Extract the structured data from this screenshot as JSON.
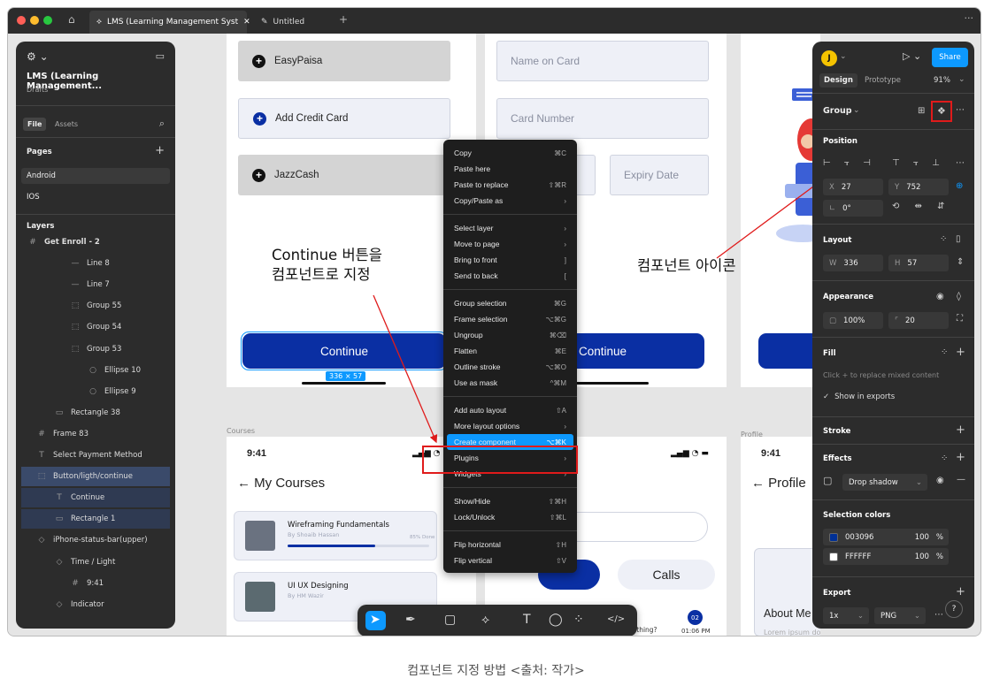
{
  "titlebar": {
    "tabs": [
      {
        "label": "LMS (Learning Management Syst"
      },
      {
        "label": "Untitled"
      }
    ],
    "more": "···"
  },
  "left_panel": {
    "project_title": "LMS (Learning Management...",
    "project_subtitle": "Drafts",
    "file_tab": "File",
    "assets_tab": "Assets",
    "pages_label": "Pages",
    "pages": [
      "Android",
      "IOS"
    ],
    "layers_label": "Layers",
    "layers": [
      {
        "label": "Get Enroll - 2",
        "icon": "#"
      },
      {
        "label": "Line 8",
        "icon": "—"
      },
      {
        "label": "Line 7",
        "icon": "—"
      },
      {
        "label": "Group 55",
        "icon": "⬚"
      },
      {
        "label": "Group 54",
        "icon": "⬚"
      },
      {
        "label": "Group 53",
        "icon": "⬚"
      },
      {
        "label": "Ellipse 10",
        "icon": "○"
      },
      {
        "label": "Ellipse 9",
        "icon": "○"
      },
      {
        "label": "Rectangle 38",
        "icon": "▭"
      },
      {
        "label": "Frame 83",
        "icon": "#"
      },
      {
        "label": "Select Payment Method",
        "icon": "T"
      },
      {
        "label": "Button/ligth/continue",
        "icon": "⬚"
      },
      {
        "label": "Continue",
        "icon": "T"
      },
      {
        "label": "Rectangle 1",
        "icon": "▭"
      },
      {
        "label": "iPhone-status-bar(upper)",
        "icon": "◇"
      },
      {
        "label": "Time / Light",
        "icon": "◇"
      },
      {
        "label": "9:41",
        "icon": "#"
      },
      {
        "label": "Indicator",
        "icon": "◇"
      }
    ]
  },
  "canvas": {
    "payment_methods": [
      "EasyPaisa",
      "Add Credit Card",
      "JazzCash"
    ],
    "fields": {
      "name_on_card": "Name on Card",
      "card_number": "Card Number",
      "expiry_date": "Expiry Date"
    },
    "continue_label": "Continue",
    "selection_size": "336 × 57",
    "frame_labels": {
      "courses": "Courses",
      "profile": "Profile"
    },
    "courses_frame": {
      "time": "9:41",
      "title": "← My Courses",
      "courses": [
        {
          "name": "Wireframing Fundamentals",
          "author": "By Shoaib Hassan",
          "progress_text": "85% Done",
          "progress": 0.62
        },
        {
          "name": "UI UX Designing",
          "author": "By HM Wazir"
        }
      ]
    },
    "middle_frame": {
      "calls_label": "Calls",
      "message": "Hi, How's you? How's everything?",
      "badge": "02",
      "time_sent": "01:06 PM"
    },
    "profile_frame": {
      "time": "9:41",
      "title": "← Profile",
      "about": "About Me",
      "lorem": "Lorem ipsum dolor sit amet consectetur. Fero"
    }
  },
  "annotations": {
    "left_line1": "Continue 버튼을",
    "left_line2": "컴포넌트로 지정",
    "right": "컴포넌트 아이콘"
  },
  "context_menu": {
    "groups": [
      [
        {
          "label": "Copy",
          "shortcut": "⌘C"
        },
        {
          "label": "Paste here",
          "shortcut": ""
        },
        {
          "label": "Paste to replace",
          "shortcut": "⇧⌘R"
        },
        {
          "label": "Copy/Paste as",
          "shortcut": "›"
        }
      ],
      [
        {
          "label": "Select layer",
          "shortcut": "›"
        },
        {
          "label": "Move to page",
          "shortcut": "›"
        },
        {
          "label": "Bring to front",
          "shortcut": "]"
        },
        {
          "label": "Send to back",
          "shortcut": "["
        }
      ],
      [
        {
          "label": "Group selection",
          "shortcut": "⌘G"
        },
        {
          "label": "Frame selection",
          "shortcut": "⌥⌘G"
        },
        {
          "label": "Ungroup",
          "shortcut": "⌘⌫"
        },
        {
          "label": "Flatten",
          "shortcut": "⌘E"
        },
        {
          "label": "Outline stroke",
          "shortcut": "⌥⌘O"
        },
        {
          "label": "Use as mask",
          "shortcut": "^⌘M"
        }
      ],
      [
        {
          "label": "Add auto layout",
          "shortcut": "⇧A"
        },
        {
          "label": "More layout options",
          "shortcut": "›"
        },
        {
          "label": "Create component",
          "shortcut": "⌥⌘K"
        },
        {
          "label": "Plugins",
          "shortcut": "›"
        },
        {
          "label": "Widgets",
          "shortcut": "›"
        }
      ],
      [
        {
          "label": "Show/Hide",
          "shortcut": "⇧⌘H"
        },
        {
          "label": "Lock/Unlock",
          "shortcut": "⇧⌘L"
        }
      ],
      [
        {
          "label": "Flip horizontal",
          "shortcut": "⇧H"
        },
        {
          "label": "Flip vertical",
          "shortcut": "⇧V"
        }
      ]
    ]
  },
  "right_panel": {
    "avatar": "J",
    "share": "Share",
    "design_tab": "Design",
    "prototype_tab": "Prototype",
    "zoom": "91%",
    "group_label": "Group",
    "position_label": "Position",
    "x_label": "X",
    "x_value": "27",
    "y_label": "Y",
    "y_value": "752",
    "rotation": "0°",
    "layout_label": "Layout",
    "w_label": "W",
    "w_value": "336",
    "h_label": "H",
    "h_value": "57",
    "appearance_label": "Appearance",
    "opacity": "100%",
    "radius": "20",
    "fill_label": "Fill",
    "fill_hint": "Click + to replace mixed content",
    "show_in_exports": "Show in exports",
    "stroke_label": "Stroke",
    "effects_label": "Effects",
    "drop_shadow": "Drop shadow",
    "selection_colors_label": "Selection colors",
    "colors": [
      {
        "hex": "003096",
        "swatch": "#003096",
        "opacity": "100",
        "unit": "%"
      },
      {
        "hex": "FFFFFF",
        "swatch": "#FFFFFF",
        "opacity": "100",
        "unit": "%"
      }
    ],
    "export_label": "Export",
    "export_scale": "1x",
    "export_format": "PNG",
    "help": "?"
  },
  "colors": {
    "accent": "#0d99ff",
    "brand": "#0a2fa3",
    "highlight": "#e01b1b"
  },
  "caption": "컴포넌트 지정 방법 <출처: 작가>"
}
